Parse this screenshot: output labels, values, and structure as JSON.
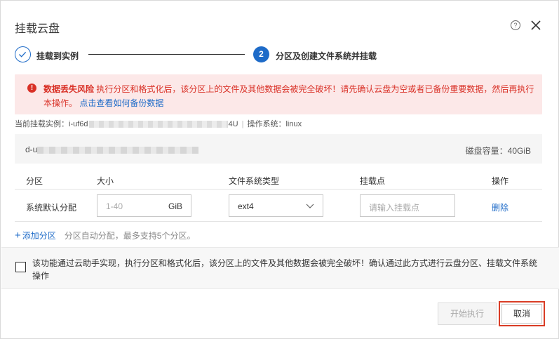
{
  "dialog": {
    "title": "挂载云盘",
    "help_icon_glyph": "?",
    "icons": [
      "help-icon",
      "close-icon"
    ]
  },
  "steps": [
    {
      "label": "挂载到实例",
      "status": "done"
    },
    {
      "number": "2",
      "label": "分区及创建文件系统并挂载",
      "status": "active"
    }
  ],
  "warning": {
    "icon_glyph": "!",
    "title": "数据丢失风险",
    "text": "执行分区和格式化后，该分区上的文件及其他数据会被完全破坏！请先确认云盘为空或者已备份重要数据，然后再执行本操作。",
    "link": "点击查看如何备份数据"
  },
  "instance": {
    "label": "当前挂载实例：",
    "id_prefix": "i-uf6d",
    "id_suffix": "4U",
    "os_label": "操作系统：",
    "os": "linux"
  },
  "disk": {
    "id_prefix": "d-u",
    "capacity_label": "磁盘容量：",
    "capacity": "40GiB"
  },
  "table": {
    "headers": {
      "partition": "分区",
      "size": "大小",
      "fs_type": "文件系统类型",
      "mount_point": "挂载点",
      "action": "操作"
    },
    "rows": [
      {
        "name": "系统默认分配",
        "size_placeholder": "1-40",
        "size_unit": "GiB",
        "fs_type": "ext4",
        "mount_placeholder": "请输入挂载点",
        "action": "删除"
      }
    ]
  },
  "add_partition": {
    "plus": "+",
    "label": "添加分区",
    "hint": "分区自动分配，最多支持5个分区。"
  },
  "confirm": {
    "checked": false,
    "text": "该功能通过云助手实现，执行分区和格式化后，该分区上的文件及其他数据会被完全破坏！确认通过此方式进行云盘分区、挂载文件系统操作"
  },
  "footer": {
    "start_label": "开始执行",
    "start_disabled": true,
    "cancel_label": "取消"
  },
  "colors": {
    "primary": "#1e6bc8",
    "danger": "#d93026",
    "warning_bg": "#fce8e8",
    "cancel_highlight": "#d93d26"
  }
}
